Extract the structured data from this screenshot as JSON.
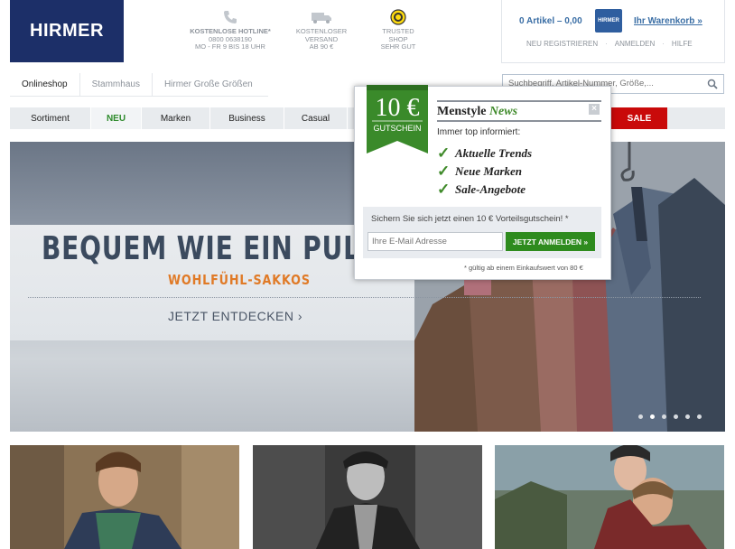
{
  "header": {
    "logo": "HIRMER",
    "usps": [
      {
        "line1": "Kostenlose Hotline*",
        "line2": "0800 0638190",
        "line3": "MO - FR 9 BIS 18 UHR"
      },
      {
        "line1": "",
        "line2": "KOSTENLOSER",
        "line3": "VERSAND",
        "line4": "AB 90 €"
      },
      {
        "line1": "",
        "line2": "TRUSTED",
        "line3": "SHOP",
        "line4": "SEHR GUT"
      }
    ],
    "cart": {
      "count": "0 Artikel – 0,00",
      "bag_label": "HIRMER",
      "link": "Ihr Warenkorb »"
    },
    "account_links": [
      "Neu registrieren",
      "Anmelden",
      "Hilfe"
    ]
  },
  "tabs": [
    "Onlineshop",
    "Stammhaus",
    "Hirmer Große Größen"
  ],
  "search": {
    "placeholder": "Suchbegriff, Artikel-Nummer, Größe,..."
  },
  "categories": [
    "Sortiment",
    "NEU",
    "Marken",
    "Business",
    "Casual",
    "SALE"
  ],
  "hero": {
    "title": "BEQUEM WIE EIN PULLOVER",
    "subtitle": "WOHLFÜHL-SAKKOS",
    "cta": "JETZT ENTDECKEN ›",
    "slides": 6,
    "active_slide": 2
  },
  "popup": {
    "voucher_amount": "10 €",
    "voucher_label": "GUTSCHEIN",
    "title_part1": "Menstyle",
    "title_part2": "News",
    "close": "×",
    "intro": "Immer top informiert:",
    "benefits": [
      "Aktuelle Trends",
      "Neue Marken",
      "Sale-Angebote"
    ],
    "claim": "Sichern Sie sich jetzt einen 10 € Vorteilsgutschein! *",
    "email_placeholder": "Ihre E-Mail Adresse",
    "button": "JETZT ANMELDEN »",
    "footnote": "* gültig ab einem Einkaufswert von 80 €"
  },
  "colors": {
    "navy": "#1c2f68",
    "green": "#2e8b1e",
    "sale_red": "#c90a0a",
    "orange": "#e07a27",
    "link_blue": "#3a6ea5"
  }
}
